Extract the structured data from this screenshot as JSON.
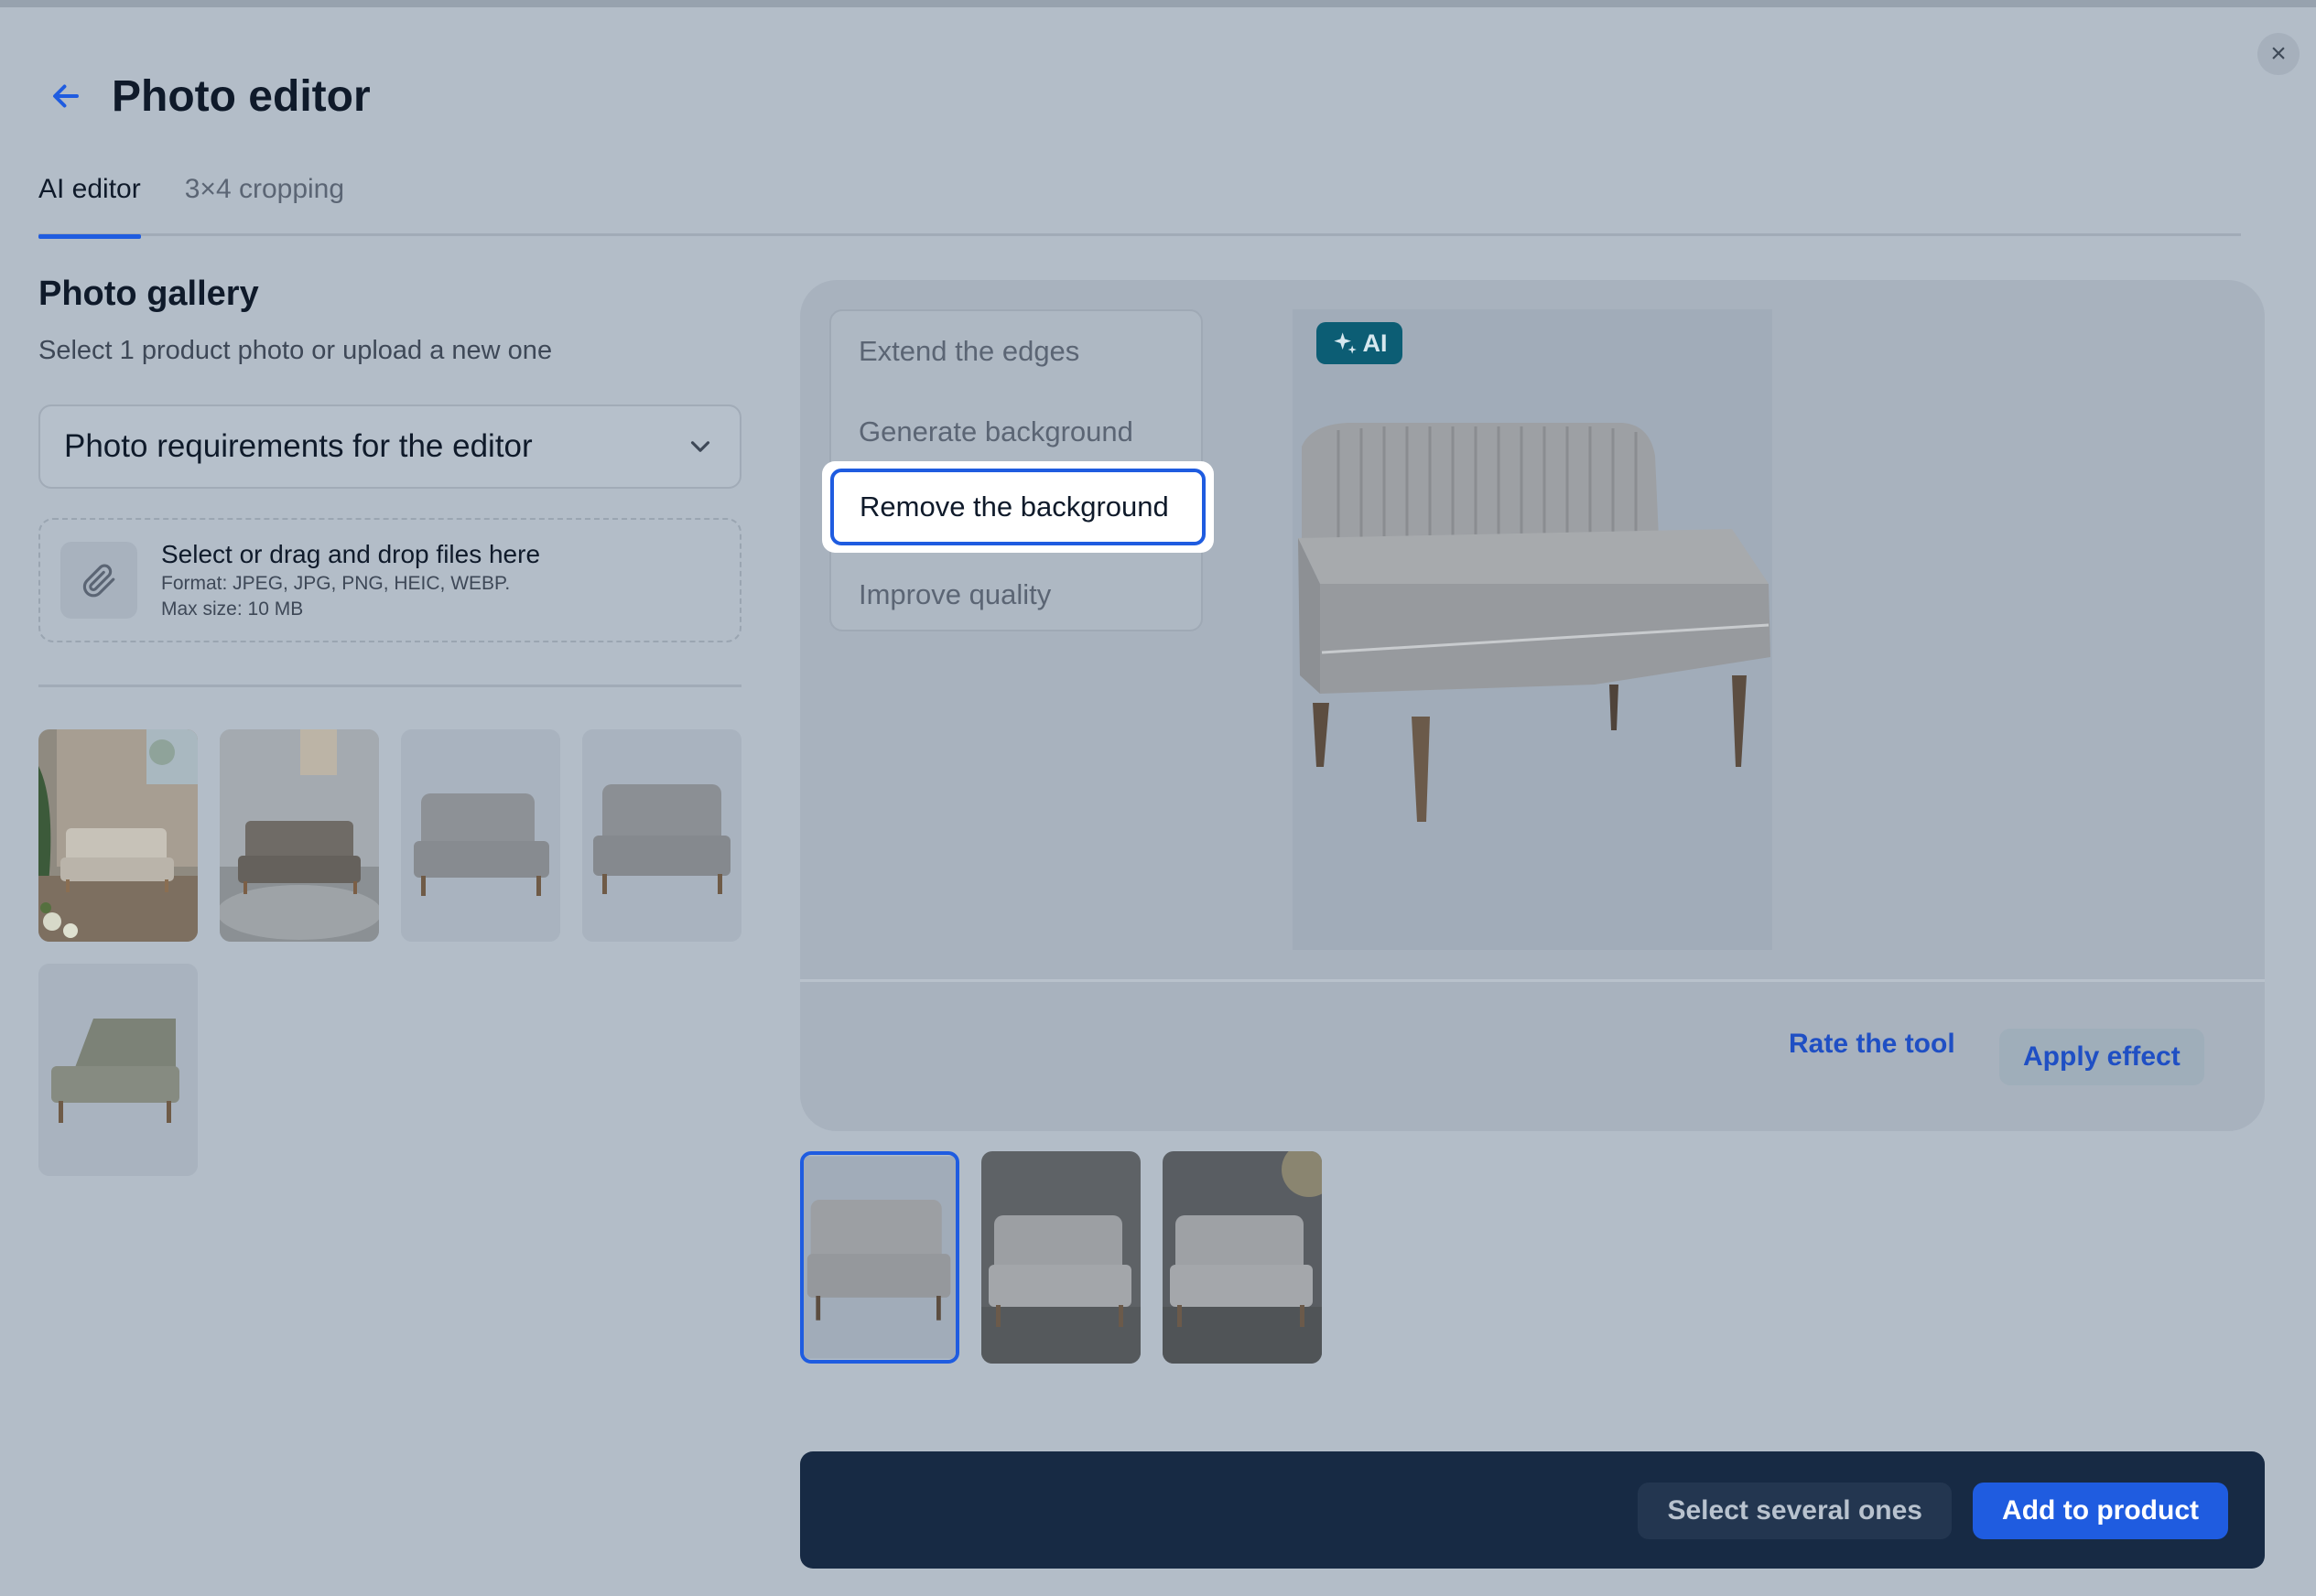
{
  "window": {
    "title": "Photo editor",
    "close_glyph": "×"
  },
  "tabs": [
    {
      "label": "AI editor",
      "active": true
    },
    {
      "label": "3×4 cropping",
      "active": false
    }
  ],
  "gallery": {
    "title": "Photo gallery",
    "subtitle": "Select 1 product photo or upload a new one",
    "requirements_label": "Photo requirements for the editor",
    "upload": {
      "main": "Select or drag and drop files here",
      "format": "Format: JPEG, JPG, PNG, HEIC, WEBP.",
      "size": "Max size: 10 MB"
    }
  },
  "tools": {
    "items": [
      {
        "label": "Extend the edges",
        "selected": false
      },
      {
        "label": "Generate background",
        "selected": false
      },
      {
        "label": "Remove the background",
        "selected": true
      },
      {
        "label": "Improve quality",
        "selected": false
      }
    ]
  },
  "preview": {
    "badge": "AI"
  },
  "actions": {
    "rate": "Rate the tool",
    "apply": "Apply effect"
  },
  "footer": {
    "select_several": "Select several ones",
    "add_to_product": "Add to product"
  },
  "colors": {
    "accent": "#1f5ce0",
    "ai_badge": "#0c5d74",
    "footer_bg": "#172a44",
    "overlay_bg": "#b3bdc8"
  },
  "icons": [
    "back-arrow-icon",
    "close-icon",
    "chevron-down-icon",
    "paperclip-icon",
    "sparkle-icon"
  ]
}
